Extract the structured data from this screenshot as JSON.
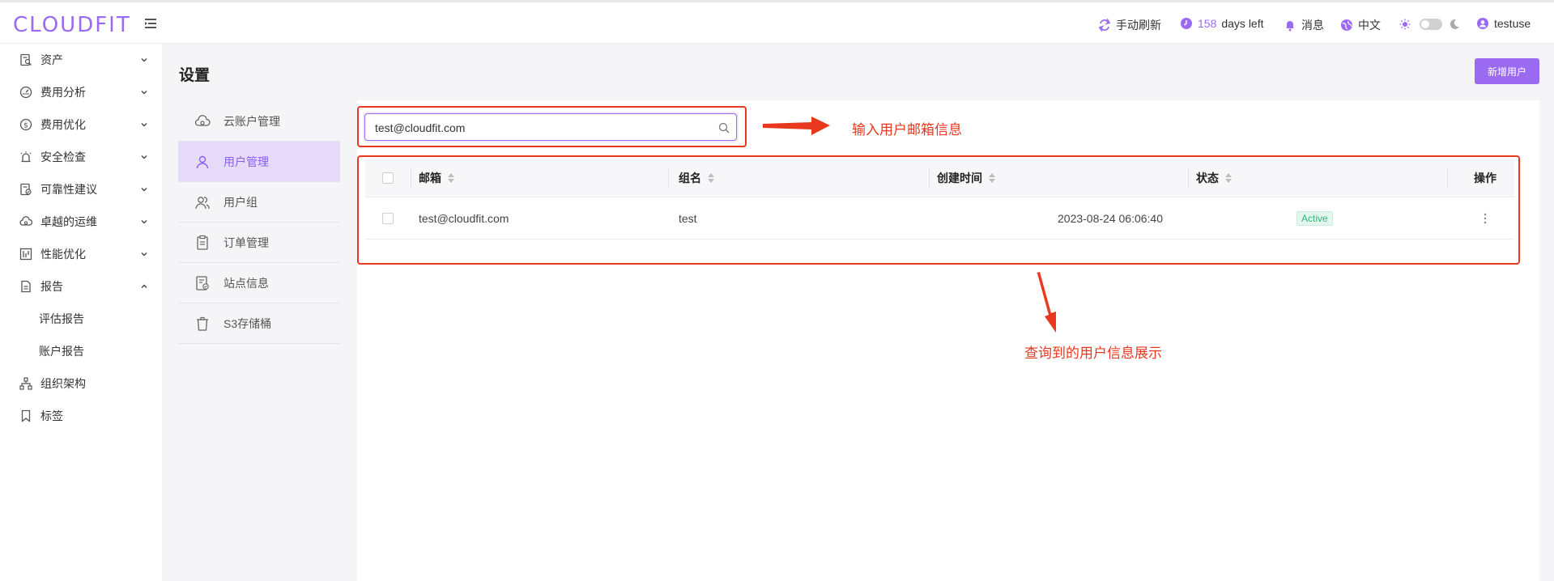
{
  "header": {
    "logo": "CLOUDFIT",
    "refresh_label": "手动刷新",
    "days_count": "158",
    "days_suffix": "days left",
    "messages_label": "消息",
    "language_label": "中文",
    "user_name": "testuser"
  },
  "sidebar": {
    "items": [
      {
        "label": "资产",
        "icon": "asset-icon",
        "chevron": "down"
      },
      {
        "label": "费用分析",
        "icon": "gauge-icon",
        "chevron": "down"
      },
      {
        "label": "费用优化",
        "icon": "dollar-icon",
        "chevron": "down"
      },
      {
        "label": "安全检查",
        "icon": "alarm-icon",
        "chevron": "down"
      },
      {
        "label": "可靠性建议",
        "icon": "doc-check-icon",
        "chevron": "down"
      },
      {
        "label": "卓越的运维",
        "icon": "cloud-gear-icon",
        "chevron": "down"
      },
      {
        "label": "性能优化",
        "icon": "chart-icon",
        "chevron": "down"
      },
      {
        "label": "报告",
        "icon": "report-icon",
        "chevron": "up"
      },
      {
        "label": "评估报告",
        "sub": true
      },
      {
        "label": "账户报告",
        "sub": true
      },
      {
        "label": "组织架构",
        "icon": "org-icon"
      },
      {
        "label": "标签",
        "icon": "bookmark-icon"
      }
    ]
  },
  "page": {
    "title": "设置",
    "add_user_label": "新增用户"
  },
  "settings_menu": {
    "items": [
      {
        "label": "云账户管理",
        "icon": "cloud-account-icon"
      },
      {
        "label": "用户管理",
        "icon": "user-icon",
        "active": true
      },
      {
        "label": "用户组",
        "icon": "user-group-icon"
      },
      {
        "label": "订单管理",
        "icon": "order-icon"
      },
      {
        "label": "站点信息",
        "icon": "site-info-icon"
      },
      {
        "label": "S3存储桶",
        "icon": "bucket-icon"
      }
    ]
  },
  "search": {
    "value": "test@cloudfit.com",
    "placeholder": ""
  },
  "table": {
    "columns": [
      "邮箱",
      "组名",
      "创建时间",
      "状态",
      "操作"
    ],
    "rows": [
      {
        "email": "test@cloudfit.com",
        "group": "test",
        "created": "2023-08-24 06:06:40",
        "status": "Active"
      }
    ]
  },
  "annotations": {
    "search_note": "输入用户邮箱信息",
    "result_note": "查询到的用户信息展示"
  },
  "colors": {
    "accent": "#9a6bf0",
    "annotation": "#e8391f",
    "active_bg": "#e6dcf9",
    "status_active": "#36b37e"
  }
}
